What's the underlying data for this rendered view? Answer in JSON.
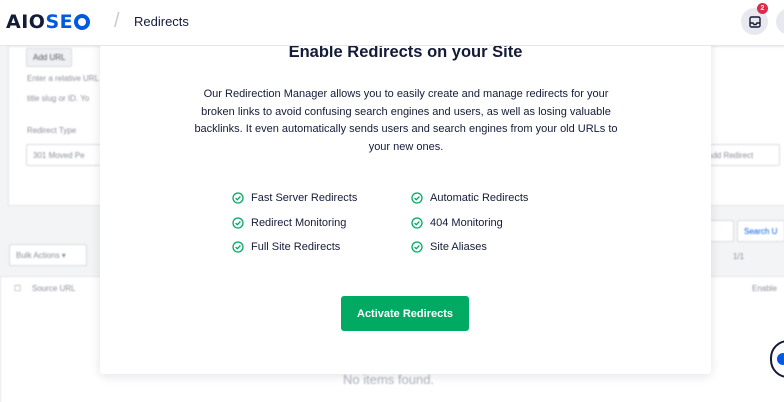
{
  "header": {
    "logo_main": "AIO",
    "logo_seo": "SE",
    "breadcrumb_sep": "/",
    "breadcrumb": "Redirects",
    "notification_count": "2"
  },
  "background": {
    "add_url_label": "Add URL",
    "hint_line1": "Enter a relative URL",
    "hint_line2": "title slug or ID. Yo",
    "redirect_type_label": "Redirect Type",
    "redirect_type_value": "301 Moved Pe",
    "add_redirect_label": "Add Redirect",
    "bulk_actions_label": "Bulk Actions ▾",
    "search_label": "Search U",
    "pager_label": "1/1",
    "source_url_header": "Source URL",
    "enable_header": "Enable",
    "no_items": "No items found."
  },
  "modal": {
    "title": "Enable Redirects on your Site",
    "description": "Our Redirection Manager allows you to easily create and manage redirects for your broken links to avoid confusing search engines and users, as well as losing valuable backlinks. It even automatically sends users and search engines from your old URLs to your new ones.",
    "features_left": [
      "Fast Server Redirects",
      "Redirect Monitoring",
      "Full Site Redirects"
    ],
    "features_right": [
      "Automatic Redirects",
      "404 Monitoring",
      "Site Aliases"
    ],
    "cta_label": "Activate Redirects"
  },
  "colors": {
    "brand_blue": "#005ae0",
    "success_green": "#00aa63",
    "badge_red": "#df2a4a",
    "text_dark": "#141b38"
  },
  "icons": {
    "feature": "check-circle-icon",
    "notifications": "inbox-icon"
  }
}
